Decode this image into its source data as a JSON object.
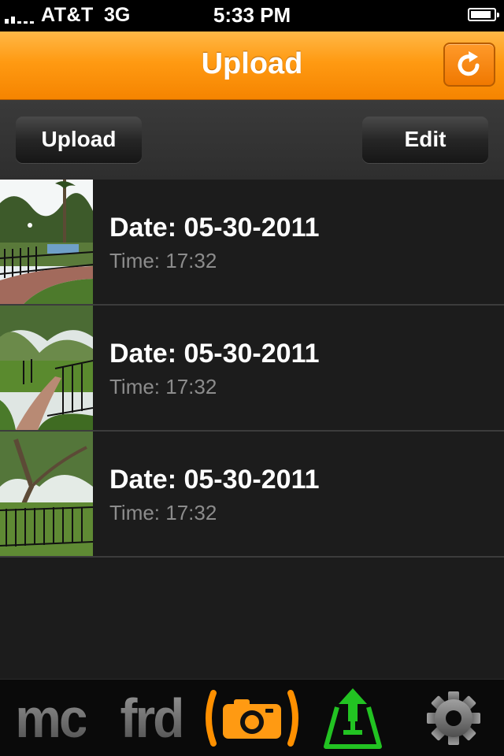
{
  "status_bar": {
    "carrier": "AT&T",
    "network": "3G",
    "time": "5:33 PM",
    "battery_level": 0.9
  },
  "nav": {
    "title": "Upload",
    "refresh_icon": "refresh-icon",
    "accent_color": "#ff9a12"
  },
  "toolbar": {
    "upload_label": "Upload",
    "edit_label": "Edit"
  },
  "uploads": [
    {
      "date": "Date: 05-30-2011",
      "time": "Time: 17:32"
    },
    {
      "date": "Date: 05-30-2011",
      "time": "Time: 17:32"
    },
    {
      "date": "Date: 05-30-2011",
      "time": "Time: 17:32"
    }
  ],
  "tabs": {
    "me_label": "mc",
    "friends_label": "frd",
    "camera_icon": "camera-icon",
    "upload_icon": "upload-icon",
    "settings_icon": "gear-icon",
    "active_tab": "camera"
  }
}
